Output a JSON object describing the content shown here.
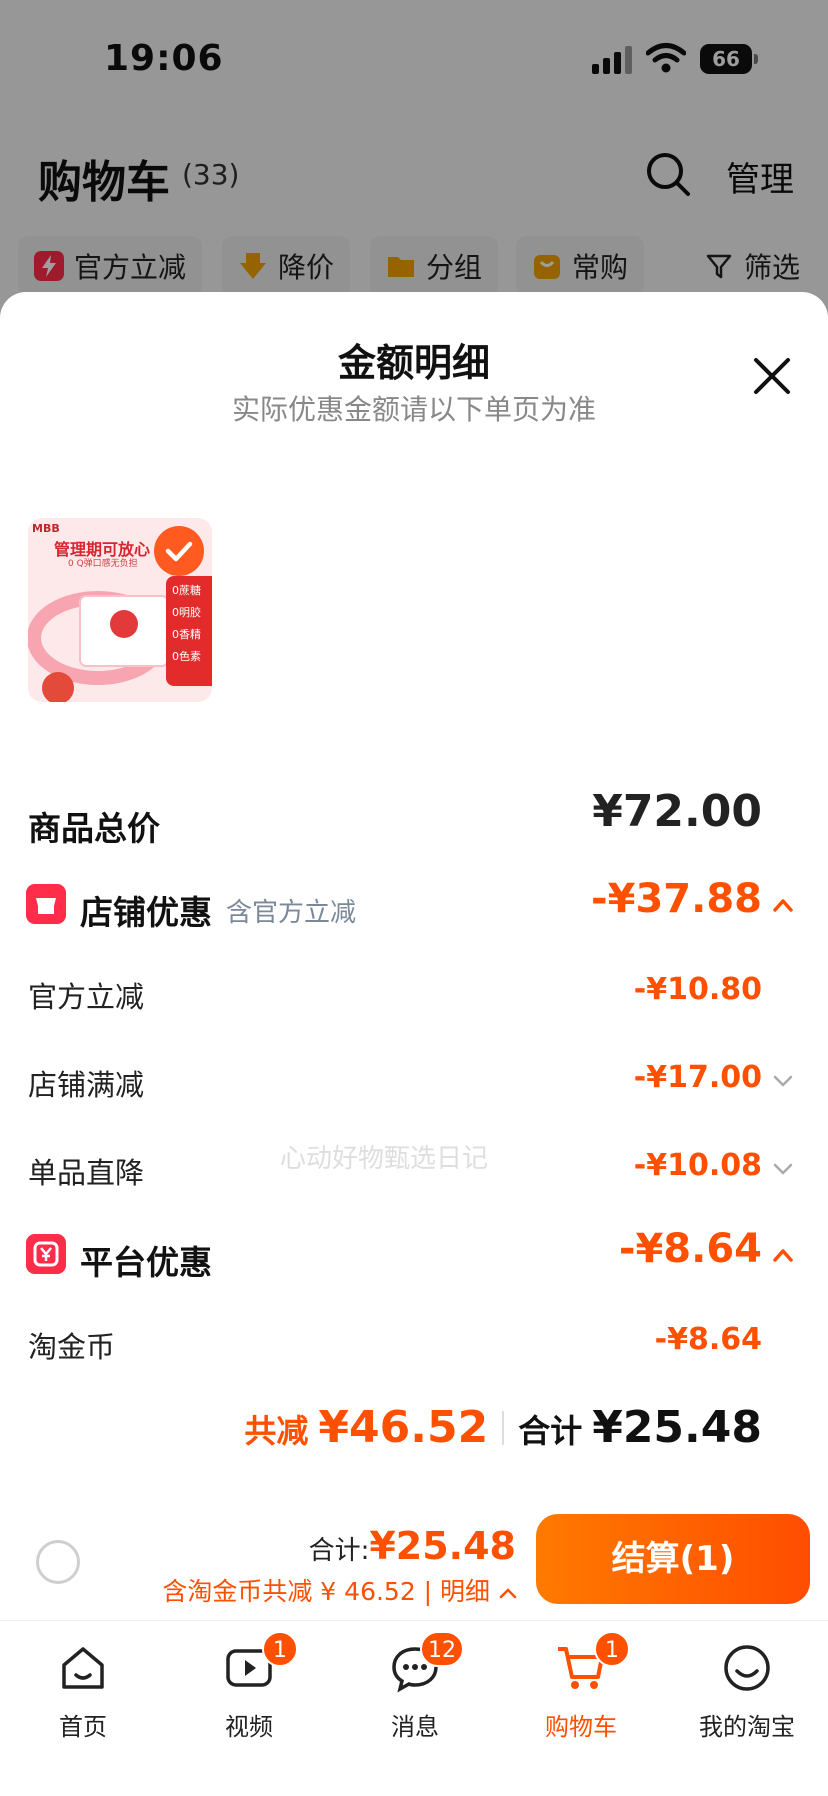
{
  "status_bar": {
    "time": "19:06",
    "battery": "66"
  },
  "cart_header": {
    "title": "购物车",
    "count": "(33)",
    "manage_label": "管理"
  },
  "filters": [
    {
      "label": "官方立减",
      "icon": "lightning-icon"
    },
    {
      "label": "降价",
      "icon": "arrow-down-icon"
    },
    {
      "label": "分组",
      "icon": "folder-icon"
    },
    {
      "label": "常购",
      "icon": "bag-icon"
    },
    {
      "label": "筛选",
      "icon": "filter-icon"
    }
  ],
  "sheet": {
    "title": "金额明细",
    "subtitle": "实际优惠金额请以下单页为准",
    "product_image": {
      "brand": "MBB",
      "headline": "管理期可放心",
      "sub": "0 Q弹口感无负担",
      "side_tags": [
        "0蔗糖",
        "0明胶",
        "0香精",
        "0色素"
      ]
    },
    "rows": {
      "goods_total": {
        "label": "商品总价",
        "value": "¥72.00"
      },
      "shop_discount": {
        "label": "店铺优惠",
        "note": "含官方立减",
        "value": "-¥37.88"
      },
      "official_cut": {
        "label": "官方立减",
        "value": "-¥10.80"
      },
      "shop_full_cut": {
        "label": "店铺满减",
        "value": "-¥17.00"
      },
      "item_direct_cut": {
        "label": "单品直降",
        "value": "-¥10.08"
      },
      "platform_discount": {
        "label": "平台优惠",
        "value": "-¥8.64"
      },
      "taojinbi": {
        "label": "淘金币",
        "value": "-¥8.64"
      }
    },
    "summary": {
      "total_cut_label": "共减",
      "total_cut_value": "¥46.52",
      "sum_label": "合计",
      "sum_value": "¥25.48"
    },
    "watermark": "心动好物甄选日记"
  },
  "checkout": {
    "total_label": "合计:",
    "total_value": "¥25.48",
    "sub_text": "含淘金币共减 ¥ 46.52 | 明细",
    "button_label": "结算(1)"
  },
  "tabs": [
    {
      "label": "首页",
      "icon": "home-icon",
      "badge": ""
    },
    {
      "label": "视频",
      "icon": "video-icon",
      "badge": "1"
    },
    {
      "label": "消息",
      "icon": "message-icon",
      "badge": "12"
    },
    {
      "label": "购物车",
      "icon": "cart-icon",
      "badge": "1",
      "active": true
    },
    {
      "label": "我的淘宝",
      "icon": "smile-icon",
      "badge": ""
    }
  ],
  "colors": {
    "accent": "#ff5000",
    "brand_red": "#ff2d4a"
  }
}
